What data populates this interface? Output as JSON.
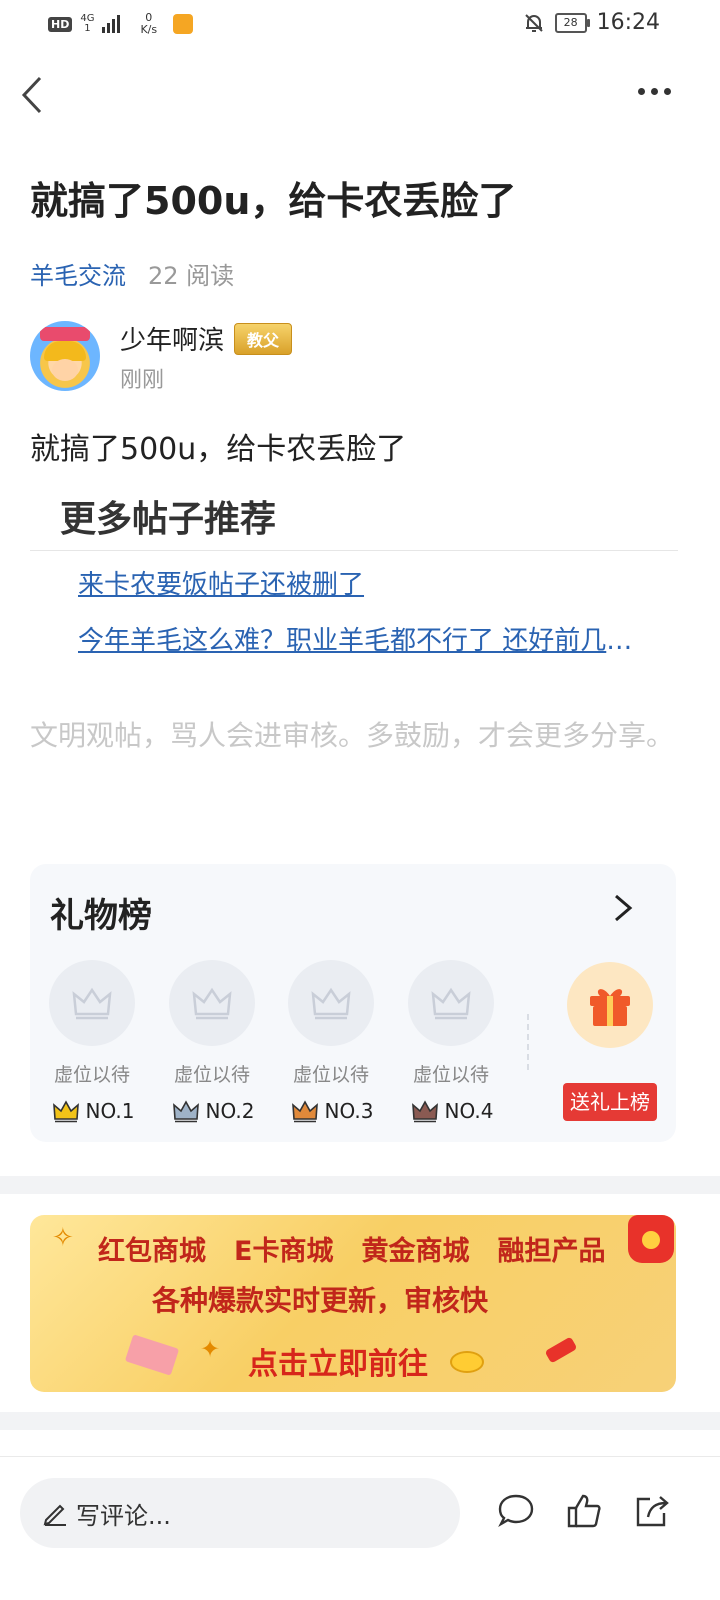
{
  "status_bar": {
    "hd": "HD",
    "network": "4G",
    "network_sub": "1",
    "speed_value": "0",
    "speed_unit": "K/s",
    "battery": "28",
    "time": "16:24"
  },
  "post": {
    "title": "就搞了500u，给卡农丢脸了",
    "category": "羊毛交流",
    "reads": "22 阅读",
    "author": "少年啊滨",
    "author_badge": "教父",
    "time": "刚刚",
    "content": "就搞了500u，给卡农丢脸了"
  },
  "recommend": {
    "title": "更多帖子推荐",
    "links": [
      "来卡农要饭帖子还被删了",
      "今年羊毛这么难？职业羊毛都不行了 还好前几天搞了个羊毛"
    ]
  },
  "notice": "文明观帖，骂人会进审核。多鼓励，才会更多分享。",
  "gift_board": {
    "title": "礼物榜",
    "slots": [
      {
        "label": "虚位以待",
        "rank": "NO.1",
        "color": "#f2c318"
      },
      {
        "label": "虚位以待",
        "rank": "NO.2",
        "color": "#9fb3c8"
      },
      {
        "label": "虚位以待",
        "rank": "NO.3",
        "color": "#e0893a"
      },
      {
        "label": "虚位以待",
        "rank": "NO.4",
        "color": "#8a5a52"
      }
    ],
    "send_label": "送礼上榜"
  },
  "banner": {
    "items": [
      "红包商城",
      "E卡商城",
      "黄金商城",
      "融担产品"
    ],
    "subtitle": "各种爆款实时更新，审核快",
    "cta": "点击立即前往"
  },
  "bottom_bar": {
    "comment_placeholder": "写评论..."
  },
  "colors": {
    "link": "#2a63b2",
    "accent_red": "#e53a35"
  }
}
